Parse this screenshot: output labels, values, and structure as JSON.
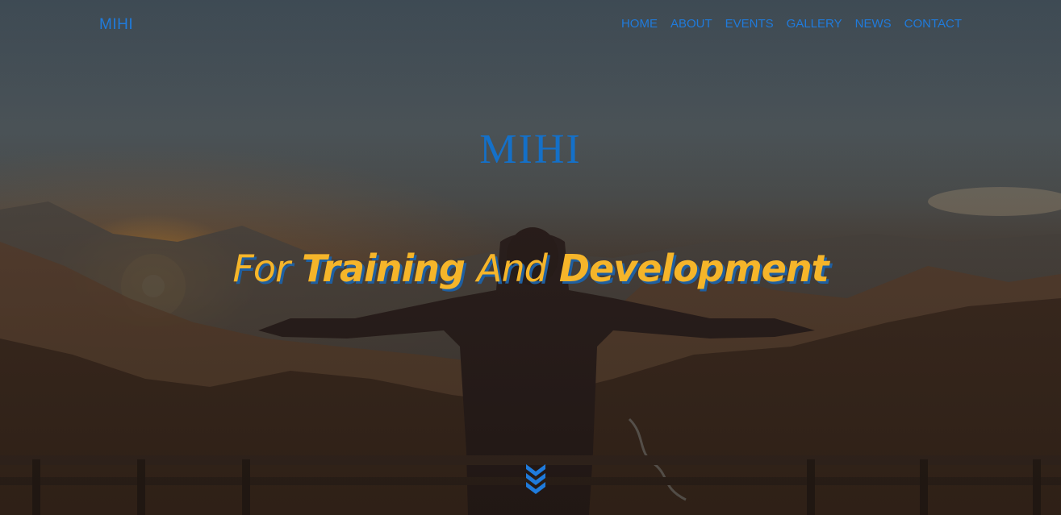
{
  "navbar": {
    "brand": "MIHI",
    "links": [
      "HOME",
      "ABOUT",
      "EVENTS",
      "GALLERY",
      "NEWS",
      "CONTACT"
    ]
  },
  "hero": {
    "title": "MIHI",
    "tagline": {
      "part1": "For",
      "part2": "Training",
      "part3": "And",
      "part4": "Development"
    },
    "scroll_icon": "chevron-double-down-icon"
  },
  "colors": {
    "accent_blue": "#1f7bdc",
    "title_blue": "#1470c8",
    "tagline_gold": "#f5b52a",
    "tagline_shadow": "#1f5fa0"
  }
}
